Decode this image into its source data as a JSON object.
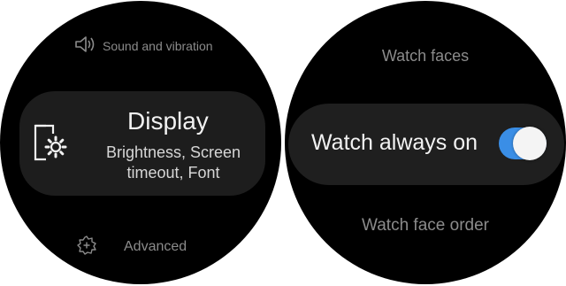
{
  "left_watch": {
    "sound_item": {
      "icon": "speaker-icon",
      "label": "Sound and vibration"
    },
    "display_item": {
      "icon": "display-settings-icon",
      "title": "Display",
      "subtitle": "Brightness, Screen timeout, Font"
    },
    "advanced_item": {
      "icon": "advanced-gear-icon",
      "label": "Advanced"
    }
  },
  "right_watch": {
    "watch_faces_label": "Watch faces",
    "always_on": {
      "label": "Watch always on",
      "enabled": true,
      "toggle_color": "#3a8ee6"
    },
    "watch_face_order_label": "Watch face order"
  }
}
